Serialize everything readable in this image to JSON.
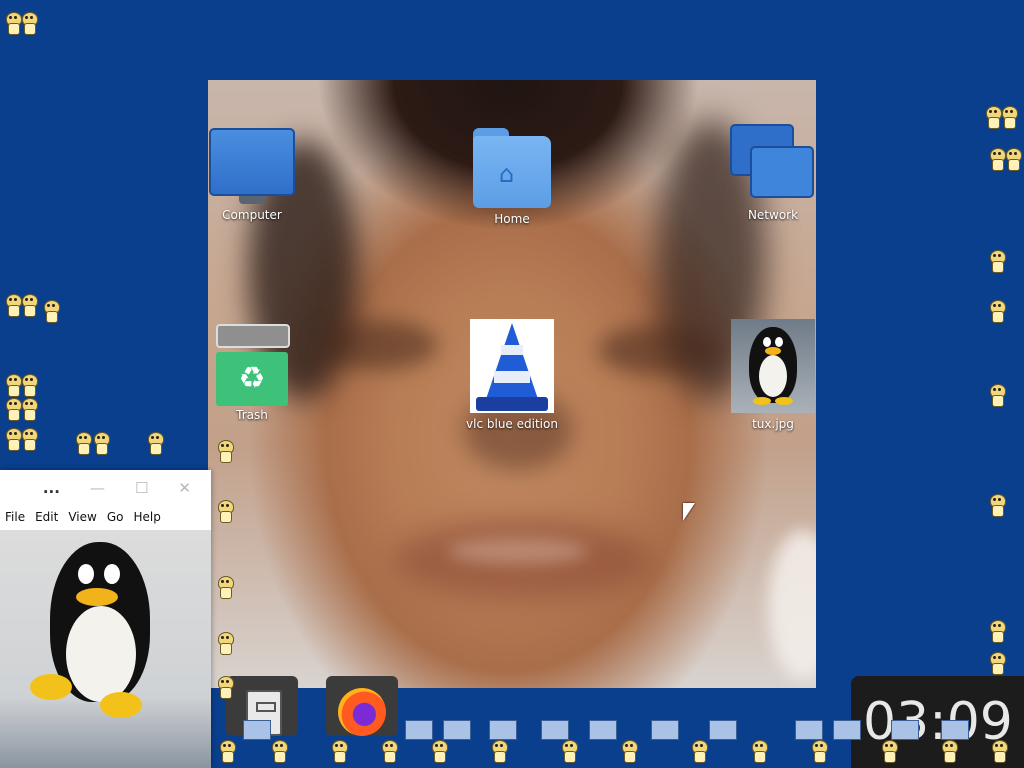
{
  "desktop": {
    "icons": [
      {
        "label": "Computer",
        "icon": "computer-icon"
      },
      {
        "label": "Home",
        "icon": "home-folder-icon"
      },
      {
        "label": "Network",
        "icon": "network-icon"
      },
      {
        "label": "Trash",
        "icon": "trash-icon"
      },
      {
        "label": "vlc blue edition",
        "icon": "vlc-icon"
      },
      {
        "label": "tux.jpg",
        "icon": "image-file-icon"
      }
    ]
  },
  "window": {
    "title": "...",
    "controls": {
      "minimize": "—",
      "maximize": "☐",
      "close": "✕"
    },
    "menu": [
      "File",
      "Edit",
      "View",
      "Go",
      "Help"
    ]
  },
  "dock": {
    "items": [
      {
        "icon": "file-cabinet-icon"
      },
      {
        "icon": "firefox-icon"
      }
    ]
  },
  "clock": {
    "time": "03:09"
  },
  "colors": {
    "background": "#0a3f8e",
    "accent": "#2f6fc9"
  }
}
